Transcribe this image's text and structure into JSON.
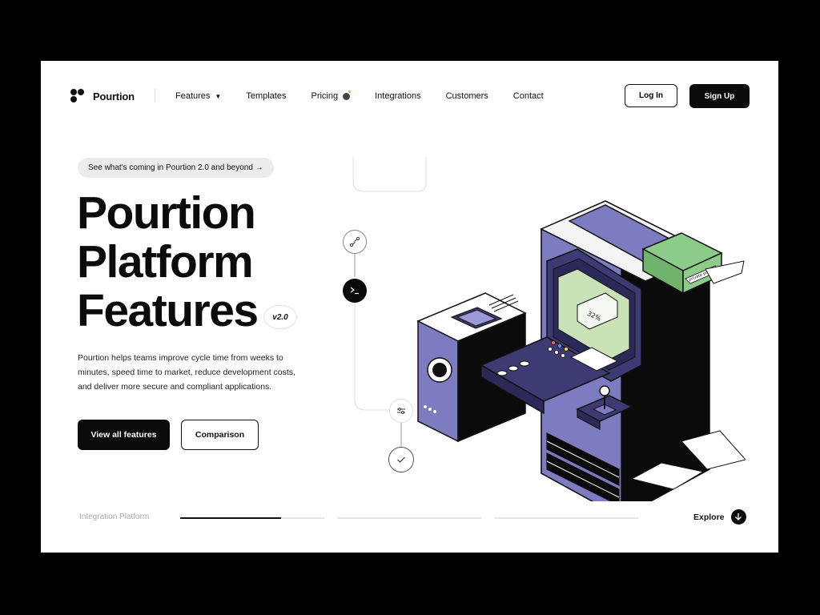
{
  "brand": {
    "name": "Pourtion"
  },
  "nav": {
    "items": [
      {
        "label": "Features",
        "icon": "chevron-down-icon"
      },
      {
        "label": "Templates"
      },
      {
        "label": "Pricing",
        "icon": "bomb-icon"
      },
      {
        "label": "Integrations"
      },
      {
        "label": "Customers"
      },
      {
        "label": "Contact"
      }
    ],
    "login_label": "Log In",
    "signup_label": "Sign Up"
  },
  "hero": {
    "announcement": "See what's coming in Pourtion 2.0 and beyond →",
    "headline": [
      "Pourtion",
      "Platform",
      "Features"
    ],
    "version_badge": "v2.0",
    "description": "Pourtion helps teams improve cycle time from weeks to minutes, speed time to market, reduce development costs, and deliver more secure and compliant applications.",
    "primary_cta": "View all features",
    "secondary_cta": "Comparison"
  },
  "illustration": {
    "screen_percent": "32%",
    "binder_label": "private project"
  },
  "footer_bar": {
    "label": "Integration Platform",
    "progress": [
      0.7,
      0,
      0
    ],
    "explore_label": "Explore"
  },
  "colors": {
    "accent_purple": "#7d7cc0",
    "dark_purple": "#3d3b74",
    "binder_green": "#8ccb8a",
    "screen_green": "#c9e3b6",
    "text": "#111111"
  }
}
